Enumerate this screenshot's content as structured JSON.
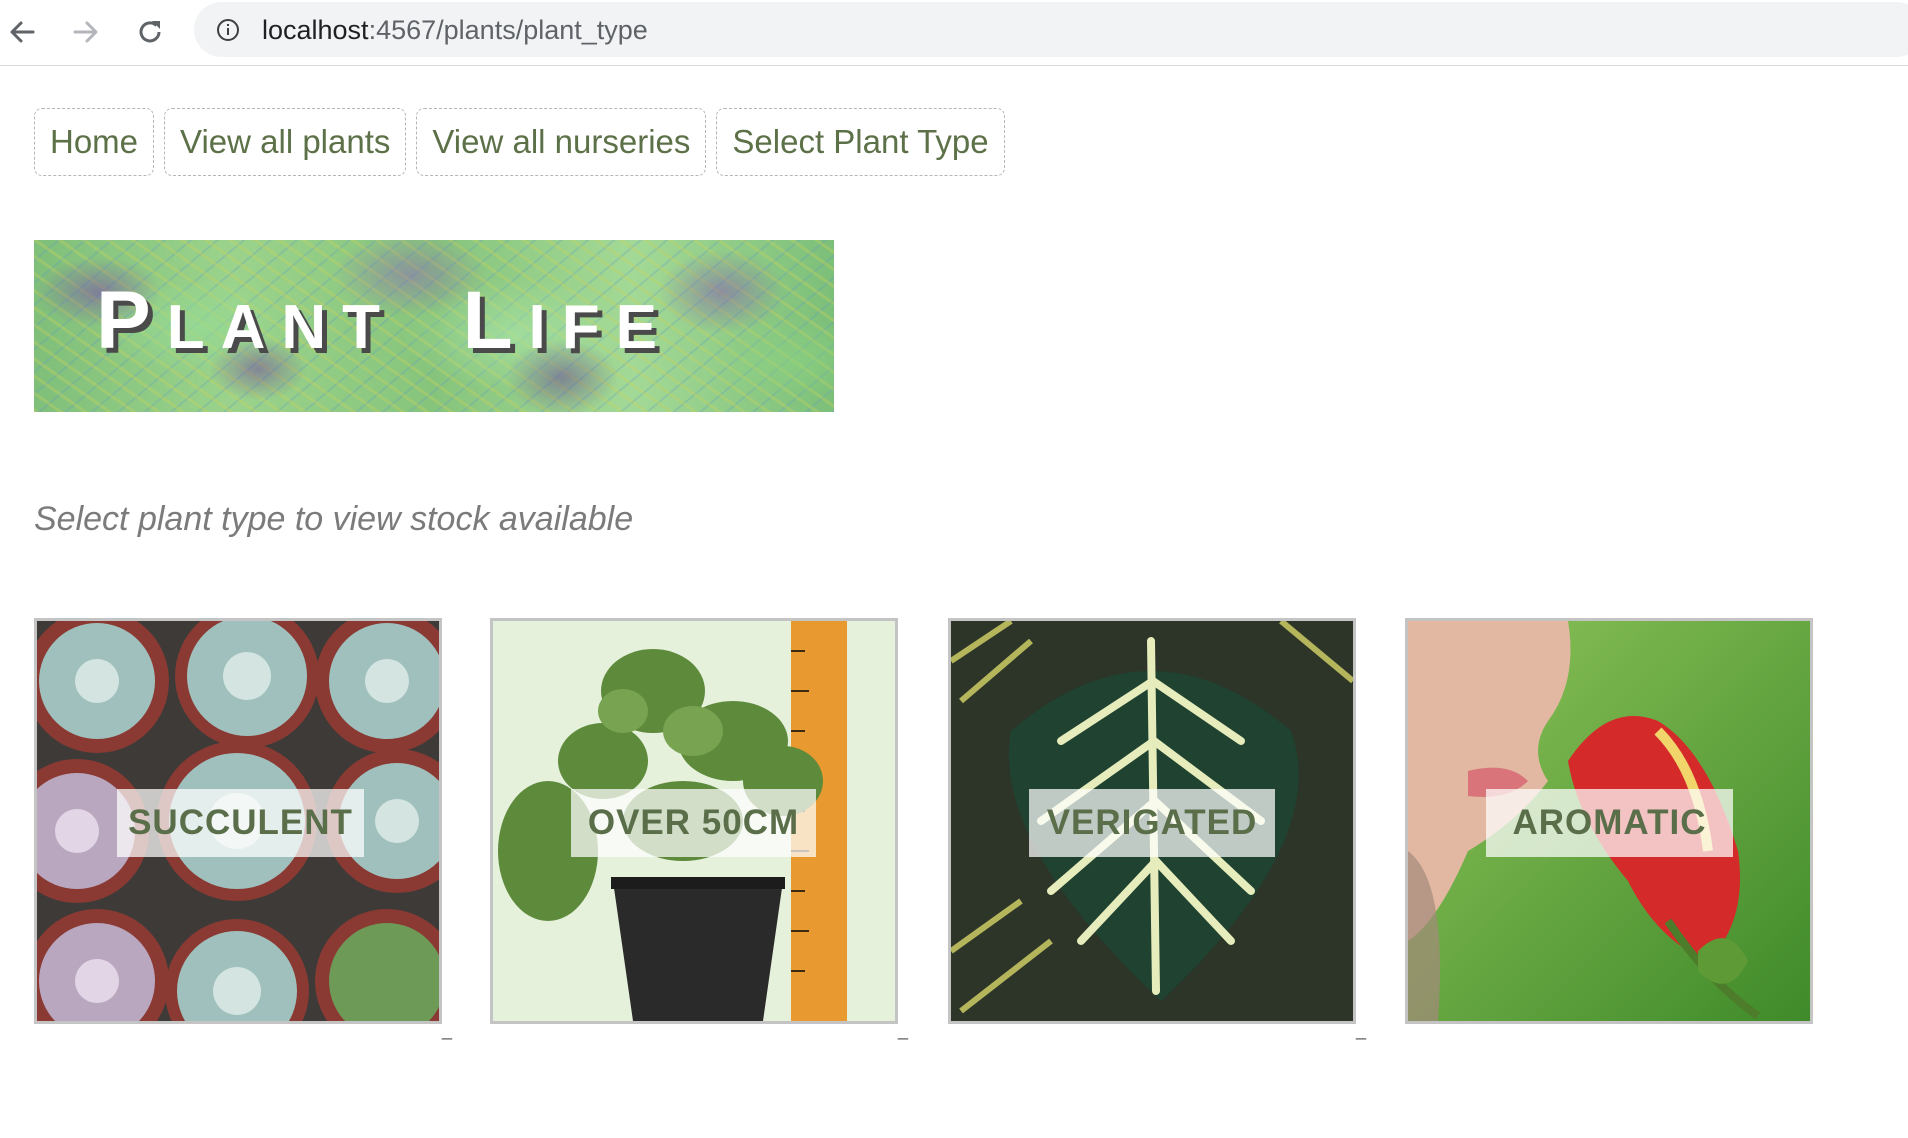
{
  "browser": {
    "url_host": "localhost",
    "url_rest": ":4567/plants/plant_type",
    "icons": [
      "back-arrow-icon",
      "forward-arrow-icon",
      "reload-icon",
      "info-icon"
    ]
  },
  "nav": {
    "items": [
      {
        "label": "Home"
      },
      {
        "label": "View all plants"
      },
      {
        "label": "View all nurseries"
      },
      {
        "label": "Select Plant Type"
      }
    ]
  },
  "banner": {
    "letters": [
      {
        "char": "P",
        "size": "big"
      },
      {
        "char": "LANT",
        "size": "small"
      },
      {
        "char": "L",
        "size": "big"
      },
      {
        "char": "IFE",
        "size": "small"
      }
    ]
  },
  "intro": {
    "text": "Select plant type to view stock available"
  },
  "plant_types": [
    {
      "label": "SUCCULENT",
      "image": "succulents-photo"
    },
    {
      "label": "OVER 50CM",
      "image": "potted-plant-with-ruler-photo"
    },
    {
      "label": "VERIGATED",
      "image": "variegated-leaf-photo"
    },
    {
      "label": "AROMATIC",
      "image": "person-smelling-red-flower-photo"
    }
  ],
  "colors": {
    "nav_text": "#5d7148",
    "label_text": "#5a6e4a",
    "intro_text": "#7b7b7b",
    "card_border": "#c4c4c4"
  }
}
